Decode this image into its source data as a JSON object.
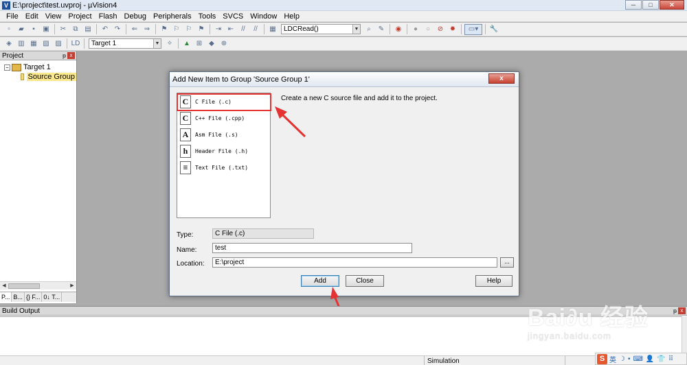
{
  "window": {
    "title": "E:\\project\\test.uvproj - µVision4",
    "controls": {
      "minimize": "─",
      "maximize": "□",
      "close": "✕"
    }
  },
  "menu": [
    "File",
    "Edit",
    "View",
    "Project",
    "Flash",
    "Debug",
    "Peripherals",
    "Tools",
    "SVCS",
    "Window",
    "Help"
  ],
  "toolbar": {
    "function_combo": "LDCRead()",
    "target_combo": "Target 1"
  },
  "project_panel": {
    "title": "Project",
    "pin": "ᵽ",
    "close": "x",
    "tree": {
      "toggle": "−",
      "target": "Target 1",
      "group": "Source Group"
    },
    "tabs": [
      "P...",
      "B...",
      "{} F...",
      "0↓ T..."
    ]
  },
  "dialog": {
    "title": "Add New Item to Group 'Source Group 1'",
    "close": "x",
    "items": [
      {
        "label": "C File (.c)",
        "icon": "C"
      },
      {
        "label": "C++ File (.cpp)",
        "icon": "C"
      },
      {
        "label": "Asm File (.s)",
        "icon": "A"
      },
      {
        "label": "Header File (.h)",
        "icon": "h"
      },
      {
        "label": "Text File (.txt)",
        "icon": "≡"
      }
    ],
    "description": "Create a new C source file and add it to the project.",
    "type_label": "Type:",
    "type_value": "C File (.c)",
    "name_label": "Name:",
    "name_value": "test",
    "location_label": "Location:",
    "location_value": "E:\\project",
    "browse": "...",
    "add_button": "Add",
    "close_button": "Close",
    "help_button": "Help"
  },
  "build_output": {
    "title": "Build Output",
    "pin": "ᵽ",
    "close": "x"
  },
  "status": {
    "mode": "Simulation"
  },
  "watermark": {
    "main": "Bai∂u 经验",
    "sub": "jingyan.baidu.com"
  },
  "tray": {
    "logo": "S",
    "ime": "英",
    "items": [
      "☽",
      "•",
      "⌨",
      "👤",
      "👕",
      "⠿"
    ]
  },
  "colors": {
    "accent_red": "#e53333",
    "dialog_bg": "#f0f0f0",
    "workspace": "#ababab"
  }
}
